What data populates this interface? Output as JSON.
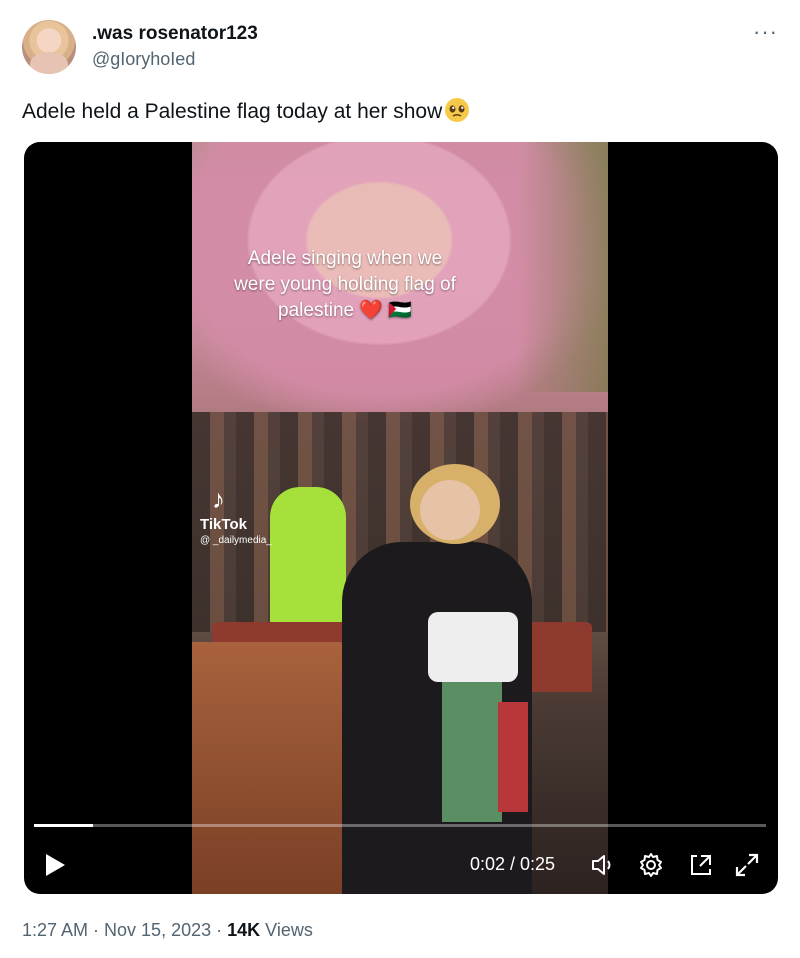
{
  "author": {
    "display_name": ".was rosenator123",
    "handle": "@gIoryhoIed",
    "more_icon": "more-icon"
  },
  "tweet": {
    "text": "Adele held a Palestine flag today at her show",
    "emoji": "pleading-face-emoji"
  },
  "video": {
    "overlay_caption_line1": "Adele singing when we",
    "overlay_caption_line2": "were young holding flag of",
    "overlay_caption_line3": "palestine ❤️ 🇵🇸",
    "watermark_brand": "TikTok",
    "watermark_user": "@ _dailymedia_",
    "progress_fraction": 0.08,
    "time_display": "0:02 / 0:25",
    "controls": [
      "play-icon",
      "volume-icon",
      "settings-icon",
      "picture-in-picture-icon",
      "fullscreen-icon"
    ]
  },
  "meta": {
    "time_date": "1:27 AM · Nov 15, 2023 · ",
    "views_count": "14K",
    "views_label": " Views"
  }
}
